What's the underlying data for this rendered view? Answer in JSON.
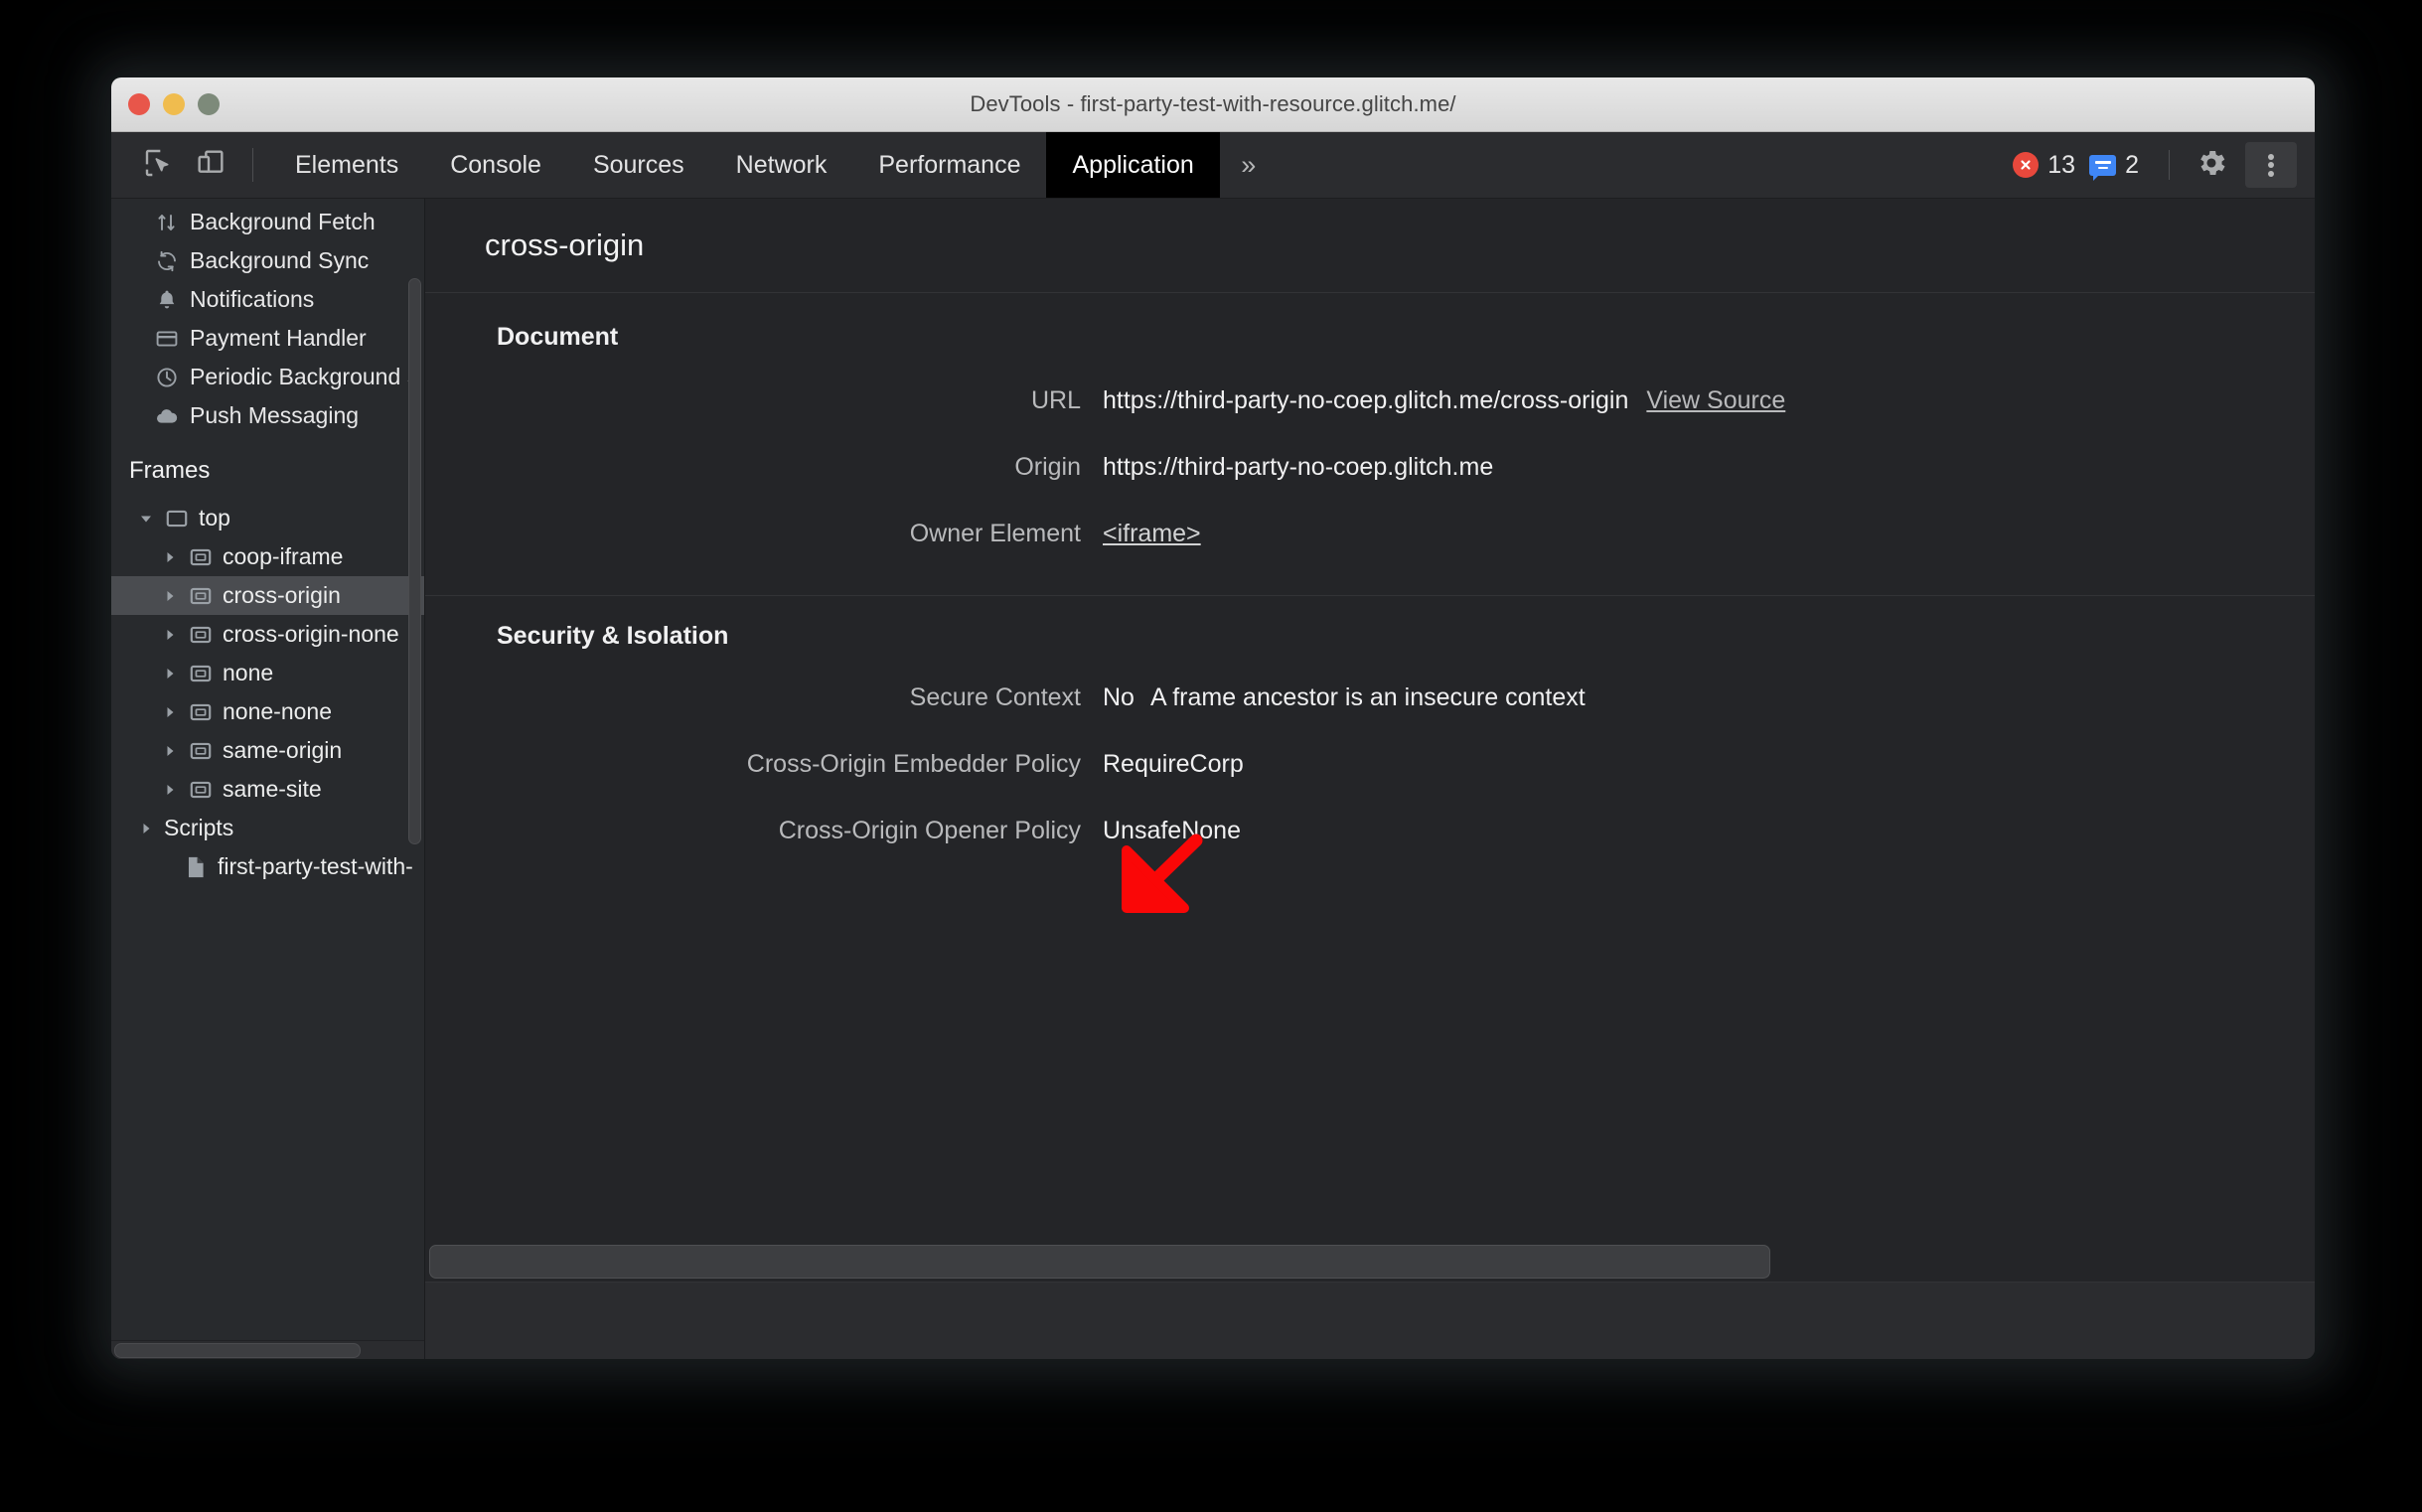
{
  "window": {
    "title": "DevTools - first-party-test-with-resource.glitch.me/",
    "controls": [
      {
        "name": "close",
        "color": "#e8564a"
      },
      {
        "name": "minimize",
        "color": "#f0bc4e"
      },
      {
        "name": "zoom",
        "color": "#7d8a7a"
      }
    ]
  },
  "toolbar": {
    "inspect_icon": "inspect-element-icon",
    "device_icon": "device-toolbar-icon",
    "tabs": [
      {
        "label": "Elements",
        "selected": false
      },
      {
        "label": "Console",
        "selected": false
      },
      {
        "label": "Sources",
        "selected": false
      },
      {
        "label": "Network",
        "selected": false
      },
      {
        "label": "Performance",
        "selected": false
      },
      {
        "label": "Application",
        "selected": true
      }
    ],
    "more_tabs": "»",
    "errors": {
      "icon": "error-icon",
      "count": "13",
      "color": "#e8483c"
    },
    "messages": {
      "icon": "message-icon",
      "count": "2",
      "color": "#3f86f5"
    },
    "settings_icon": "gear-icon",
    "menu_icon": "kebab-menu-icon"
  },
  "sidebar": {
    "items": [
      {
        "label": "Background Fetch",
        "icon": "background-fetch-icon"
      },
      {
        "label": "Background Sync",
        "icon": "background-sync-icon"
      },
      {
        "label": "Notifications",
        "icon": "bell-icon"
      },
      {
        "label": "Payment Handler",
        "icon": "credit-card-icon"
      },
      {
        "label": "Periodic Background S",
        "icon": "clock-icon"
      },
      {
        "label": "Push Messaging",
        "icon": "cloud-icon"
      }
    ],
    "frames_section": "Frames",
    "tree": [
      {
        "label": "top",
        "icon": "frame-top-icon",
        "depth": 0,
        "twisty": "down",
        "selected": false
      },
      {
        "label": "coop-iframe",
        "icon": "iframe-icon",
        "depth": 1,
        "twisty": "right",
        "selected": false
      },
      {
        "label": "cross-origin",
        "icon": "iframe-icon",
        "depth": 1,
        "twisty": "right",
        "selected": true
      },
      {
        "label": "cross-origin-none",
        "icon": "iframe-icon",
        "depth": 1,
        "twisty": "right",
        "selected": false
      },
      {
        "label": "none",
        "icon": "iframe-icon",
        "depth": 1,
        "twisty": "right",
        "selected": false
      },
      {
        "label": "none-none",
        "icon": "iframe-icon",
        "depth": 1,
        "twisty": "right",
        "selected": false
      },
      {
        "label": "same-origin",
        "icon": "iframe-icon",
        "depth": 1,
        "twisty": "right",
        "selected": false
      },
      {
        "label": "same-site",
        "icon": "iframe-icon",
        "depth": 1,
        "twisty": "right",
        "selected": false
      },
      {
        "label": "Scripts",
        "icon": "none",
        "depth": 0.6,
        "twisty": "right",
        "selected": false
      },
      {
        "label": "first-party-test-with-",
        "icon": "document-icon",
        "depth": 1.2,
        "twisty": "none",
        "selected": false
      }
    ]
  },
  "main": {
    "title": "cross-origin",
    "sections": [
      {
        "heading": "Document",
        "rows": [
          {
            "label": "URL",
            "value": "https://third-party-no-coep.glitch.me/cross-origin",
            "link": "View Source"
          },
          {
            "label": "Origin",
            "value": "https://third-party-no-coep.glitch.me"
          },
          {
            "label": "Owner Element",
            "tag_link": "<iframe>"
          }
        ]
      },
      {
        "heading": "Security & Isolation",
        "rows": [
          {
            "label": "Secure Context",
            "value": "No",
            "extra": "A frame ancestor is an insecure context"
          },
          {
            "label": "Cross-Origin Embedder Policy",
            "value": "RequireCorp"
          },
          {
            "label": "Cross-Origin Opener Policy",
            "value": "UnsafeNone"
          }
        ]
      }
    ]
  },
  "annotation": {
    "icon": "red-arrow-down-left",
    "color": "#fa0707"
  }
}
